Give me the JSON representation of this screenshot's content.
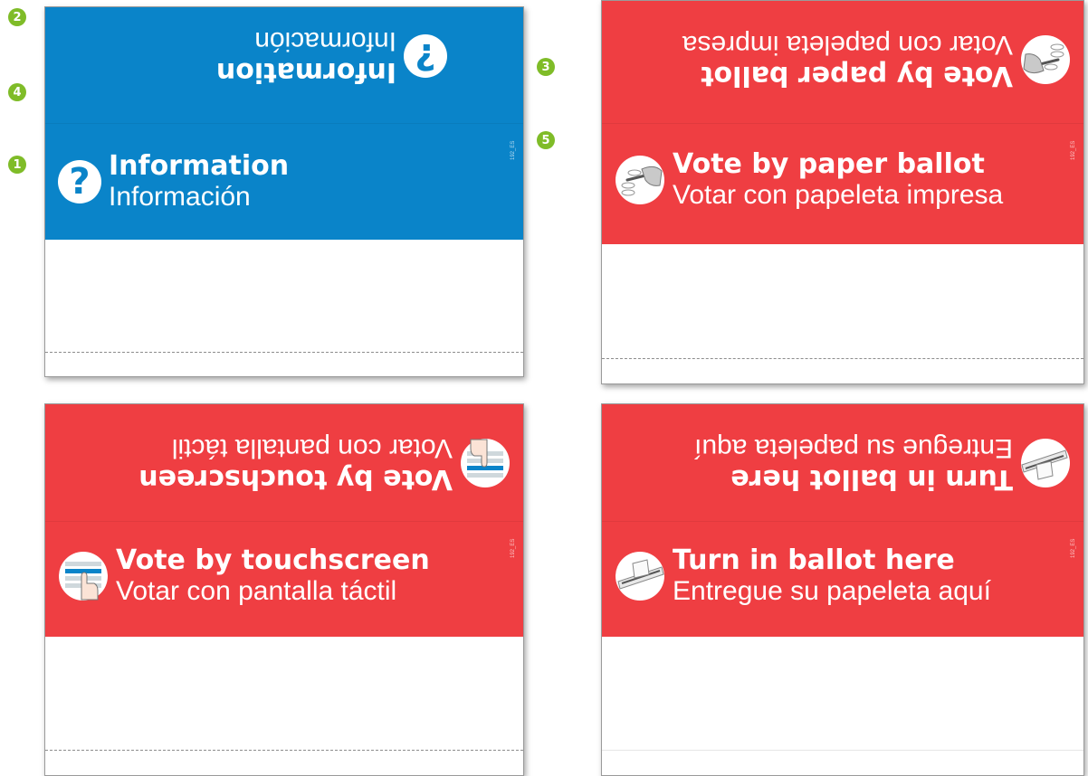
{
  "colors": {
    "info_blue": "#0a84c9",
    "vote_red": "#ef3e42",
    "marker_green": "#7fbc28"
  },
  "markers": [
    "1",
    "2",
    "3",
    "4",
    "5"
  ],
  "cards": {
    "info": {
      "en": "Information",
      "es": "Información",
      "icon": "question-mark-icon",
      "code": "192_ES"
    },
    "paper": {
      "en": "Vote by paper ballot",
      "es": "Votar con papeleta impresa",
      "icon": "paper-ballot-pen-icon",
      "code": "192_ES"
    },
    "touch": {
      "en": "Vote by touchscreen",
      "es": "Votar con pantalla táctil",
      "icon": "touchscreen-hand-icon",
      "code": "192_ES"
    },
    "turnin": {
      "en": "Turn in ballot here",
      "es": "Entregue su papeleta aquí",
      "icon": "ballot-box-slot-icon",
      "code": "192_ES"
    }
  }
}
